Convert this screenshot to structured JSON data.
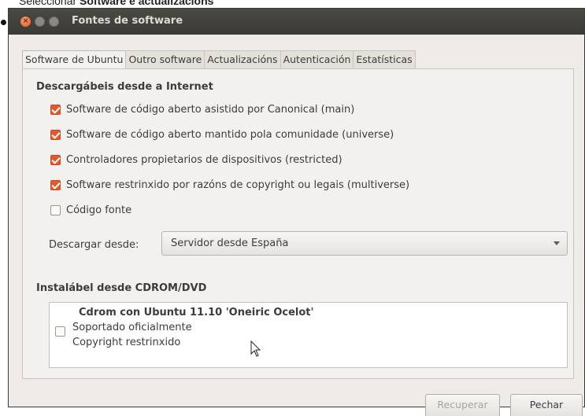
{
  "caption": {
    "prefix": "Seleccionar ",
    "bold1": "Software e actualizacións"
  },
  "window": {
    "title": "Fontes de software"
  },
  "tabs": [
    {
      "label": "Software de Ubuntu",
      "active": true
    },
    {
      "label": "Outro software"
    },
    {
      "label": "Actualizacións"
    },
    {
      "label": "Autenticación"
    },
    {
      "label": "Estatísticas"
    }
  ],
  "internet": {
    "heading": "Descargábeis desde a Internet",
    "items": [
      {
        "label": "Software de código aberto asistido por Canonical (main)",
        "checked": true
      },
      {
        "label": "Software de código aberto mantido pola comunidade (universe)",
        "checked": true
      },
      {
        "label": "Controladores propietarios de dispositivos (restricted)",
        "checked": true
      },
      {
        "label": "Software restrinxido por razóns de copyright ou legais (multiverse)",
        "checked": true
      },
      {
        "label": "Código fonte",
        "checked": false
      }
    ],
    "download_from_label": "Descargar desde:",
    "download_from_value": "Servidor desde España"
  },
  "cdrom": {
    "heading": "Instalábel desde CDROM/DVD",
    "entry_title": "Cdrom con Ubuntu 11.10 'Oneiric Ocelot'",
    "entry_line1": "Soportado oficialmente",
    "entry_line2": "Copyright restrinxido",
    "checked": false
  },
  "buttons": {
    "revert": "Recuperar",
    "close": "Pechar"
  },
  "colors": {
    "accent": "#e35a30",
    "titlebar": "#3c3b37",
    "window_bg": "#efebe7"
  }
}
